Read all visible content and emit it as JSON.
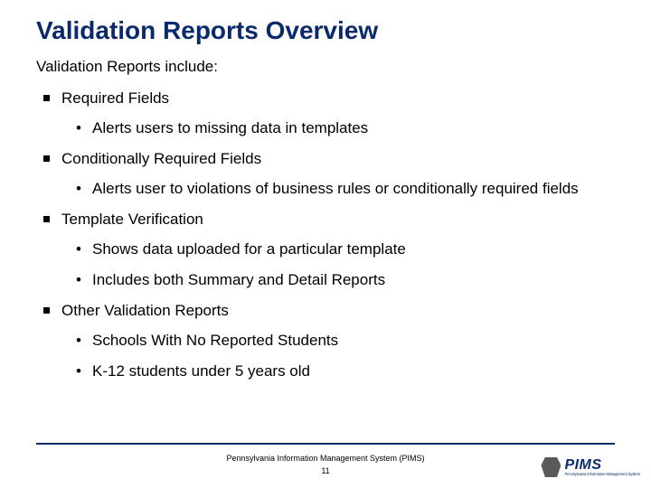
{
  "title": "Validation Reports Overview",
  "intro": "Validation Reports include:",
  "bullets": [
    {
      "label": "Required Fields",
      "sub": [
        "Alerts users to missing data in templates"
      ]
    },
    {
      "label": "Conditionally Required Fields",
      "sub": [
        "Alerts user to violations of business rules or conditionally required fields"
      ]
    },
    {
      "label": "Template Verification",
      "sub": [
        "Shows data uploaded for a particular template",
        "Includes both Summary and Detail Reports"
      ]
    },
    {
      "label": "Other Validation Reports",
      "sub": [
        "Schools With No Reported Students",
        "K-12 students under 5 years old"
      ]
    }
  ],
  "footer": "Pennsylvania Information Management System (PIMS)",
  "page_number": "11",
  "logo": {
    "main": "PIMS",
    "sub": "Pennsylvania Information Management System"
  }
}
